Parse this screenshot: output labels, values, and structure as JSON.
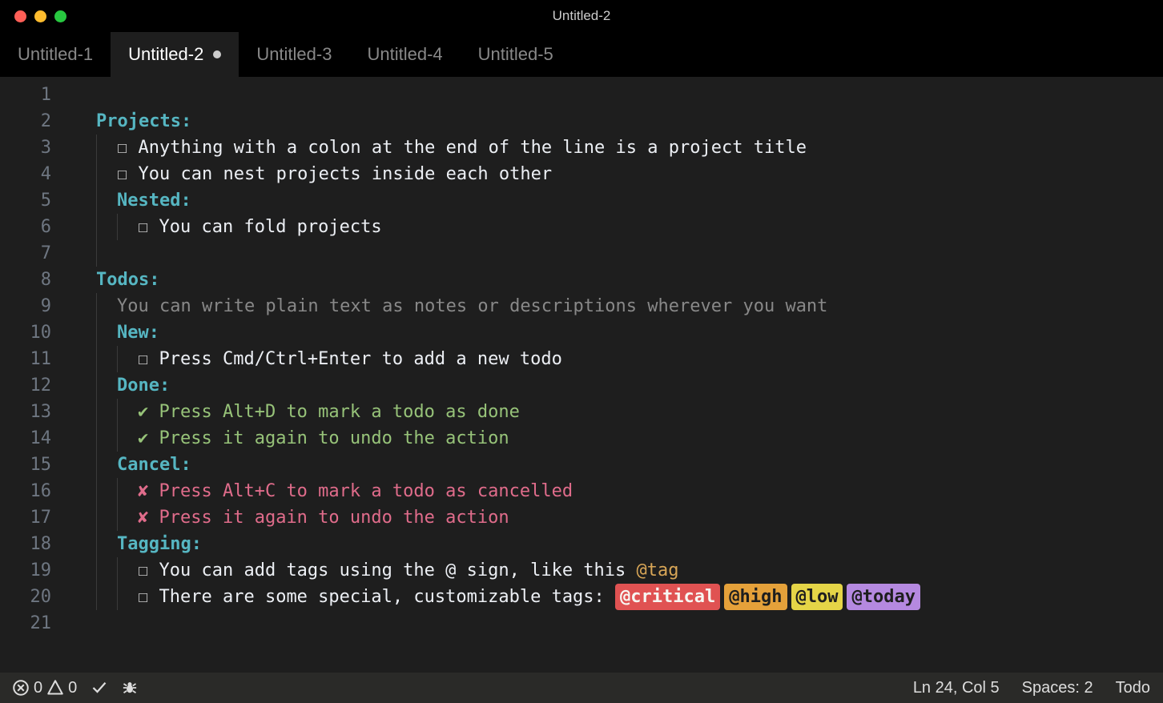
{
  "window": {
    "title": "Untitled-2"
  },
  "tabs": [
    {
      "label": "Untitled-1",
      "active": false,
      "dirty": false
    },
    {
      "label": "Untitled-2",
      "active": true,
      "dirty": true
    },
    {
      "label": "Untitled-3",
      "active": false,
      "dirty": false
    },
    {
      "label": "Untitled-4",
      "active": false,
      "dirty": false
    },
    {
      "label": "Untitled-5",
      "active": false,
      "dirty": false
    }
  ],
  "editor": {
    "line_count": 21,
    "lines": [
      {
        "indent": 0,
        "guides": [],
        "segments": []
      },
      {
        "indent": 0,
        "guides": [],
        "segments": [
          {
            "text": "Projects:",
            "class": "project"
          }
        ]
      },
      {
        "indent": 1,
        "guides": [
          0
        ],
        "segments": [
          {
            "text": "☐ ",
            "class": "bullet"
          },
          {
            "text": "Anything with a colon at the end of the line is a project title",
            "class": "normal"
          }
        ]
      },
      {
        "indent": 1,
        "guides": [
          0
        ],
        "segments": [
          {
            "text": "☐ ",
            "class": "bullet"
          },
          {
            "text": "You can nest projects inside each other",
            "class": "normal"
          }
        ]
      },
      {
        "indent": 1,
        "guides": [
          0
        ],
        "segments": [
          {
            "text": "Nested:",
            "class": "project"
          }
        ]
      },
      {
        "indent": 2,
        "guides": [
          0,
          1
        ],
        "segments": [
          {
            "text": "☐ ",
            "class": "bullet"
          },
          {
            "text": "You can fold projects",
            "class": "normal"
          }
        ]
      },
      {
        "indent": 1,
        "guides": [
          0
        ],
        "segments": []
      },
      {
        "indent": 0,
        "guides": [],
        "segments": [
          {
            "text": "Todos:",
            "class": "project"
          }
        ]
      },
      {
        "indent": 1,
        "guides": [
          0
        ],
        "segments": [
          {
            "text": "You can write plain text as notes or descriptions wherever you want",
            "class": "comment"
          }
        ]
      },
      {
        "indent": 1,
        "guides": [
          0
        ],
        "segments": [
          {
            "text": "New:",
            "class": "project"
          }
        ]
      },
      {
        "indent": 2,
        "guides": [
          0,
          1
        ],
        "segments": [
          {
            "text": "☐ ",
            "class": "bullet"
          },
          {
            "text": "Press Cmd/Ctrl+Enter to add a new todo",
            "class": "normal"
          }
        ]
      },
      {
        "indent": 1,
        "guides": [
          0
        ],
        "segments": [
          {
            "text": "Done:",
            "class": "project"
          }
        ]
      },
      {
        "indent": 2,
        "guides": [
          0,
          1
        ],
        "segments": [
          {
            "text": "✔ ",
            "class": "check"
          },
          {
            "text": "Press Alt+D to mark a todo as done",
            "class": "done"
          }
        ]
      },
      {
        "indent": 2,
        "guides": [
          0,
          1
        ],
        "segments": [
          {
            "text": "✔ ",
            "class": "check"
          },
          {
            "text": "Press it again to undo the action",
            "class": "done"
          }
        ]
      },
      {
        "indent": 1,
        "guides": [
          0
        ],
        "segments": [
          {
            "text": "Cancel:",
            "class": "project"
          }
        ]
      },
      {
        "indent": 2,
        "guides": [
          0,
          1
        ],
        "segments": [
          {
            "text": "✘ ",
            "class": "xmark"
          },
          {
            "text": "Press Alt+C to mark a todo as cancelled",
            "class": "cancelled"
          }
        ]
      },
      {
        "indent": 2,
        "guides": [
          0,
          1
        ],
        "segments": [
          {
            "text": "✘ ",
            "class": "xmark"
          },
          {
            "text": "Press it again to undo the action",
            "class": "cancelled"
          }
        ]
      },
      {
        "indent": 1,
        "guides": [
          0
        ],
        "segments": [
          {
            "text": "Tagging:",
            "class": "project"
          }
        ]
      },
      {
        "indent": 2,
        "guides": [
          0,
          1
        ],
        "segments": [
          {
            "text": "☐ ",
            "class": "bullet"
          },
          {
            "text": "You can add tags using the @ sign, like this ",
            "class": "normal"
          },
          {
            "text": "@tag",
            "class": "tag-plain"
          }
        ]
      },
      {
        "indent": 2,
        "guides": [
          0,
          1
        ],
        "segments": [
          {
            "text": "☐ ",
            "class": "bullet"
          },
          {
            "text": "There are some special, customizable tags: ",
            "class": "normal"
          },
          {
            "text": "@critical",
            "class": "badge badge-critical"
          },
          {
            "text": "@high",
            "class": "badge badge-high"
          },
          {
            "text": "@low",
            "class": "badge badge-low"
          },
          {
            "text": "@today",
            "class": "badge badge-today"
          }
        ]
      },
      {
        "indent": 0,
        "guides": [],
        "segments": []
      }
    ]
  },
  "statusbar": {
    "errors": "0",
    "warnings": "0",
    "cursor": "Ln 24, Col 5",
    "spaces": "Spaces: 2",
    "language": "Todo"
  }
}
